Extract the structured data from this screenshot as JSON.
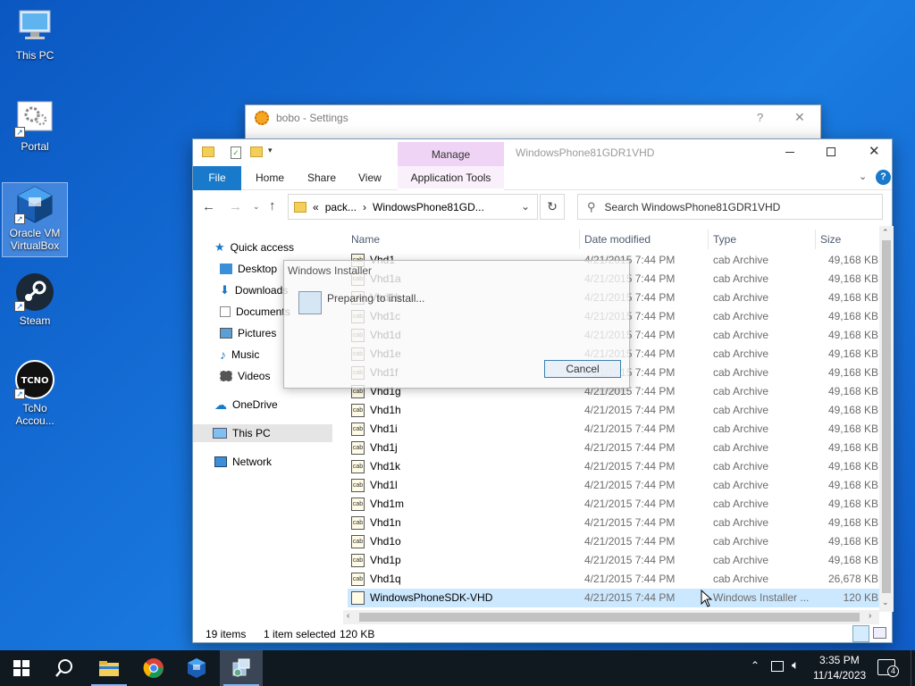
{
  "desktop": {
    "icons": [
      {
        "label": "This PC",
        "icon": "computer-icon"
      },
      {
        "label": "Portal",
        "icon": "gear-icon"
      },
      {
        "label": "Oracle VM VirtualBox",
        "icon": "virtualbox-icon"
      },
      {
        "label": "Steam",
        "icon": "steam-icon"
      },
      {
        "label": "TcNo Accou...",
        "icon": "tcno-icon"
      }
    ]
  },
  "bobo_window": {
    "title": "bobo - Settings",
    "help": "?",
    "close": "✕"
  },
  "explorer": {
    "title": "WindowsPhone81GDR1VHD",
    "manage_tab": "Manage",
    "tabs": {
      "file": "File",
      "home": "Home",
      "share": "Share",
      "view": "View",
      "app_tools": "Application Tools"
    },
    "address": {
      "prefix": "«",
      "part1": "pack...",
      "sep": "›",
      "part2": "WindowsPhone81GD..."
    },
    "search_placeholder": "Search WindowsPhone81GDR1VHD",
    "nav": {
      "quick_access": "Quick access",
      "desktop": "Desktop",
      "downloads": "Downloads",
      "documents": "Documents",
      "pictures": "Pictures",
      "music": "Music",
      "videos": "Videos",
      "onedrive": "OneDrive",
      "this_pc": "This PC",
      "network": "Network"
    },
    "columns": {
      "name": "Name",
      "date": "Date modified",
      "type": "Type",
      "size": "Size"
    },
    "files": [
      {
        "name": "Vhd1",
        "date": "4/21/2015 7:44 PM",
        "type": "cab Archive",
        "size": "49,168 KB"
      },
      {
        "name": "Vhd1a",
        "date": "4/21/2015 7:44 PM",
        "type": "cab Archive",
        "size": "49,168 KB"
      },
      {
        "name": "Vhd1b",
        "date": "4/21/2015 7:44 PM",
        "type": "cab Archive",
        "size": "49,168 KB"
      },
      {
        "name": "Vhd1c",
        "date": "4/21/2015 7:44 PM",
        "type": "cab Archive",
        "size": "49,168 KB"
      },
      {
        "name": "Vhd1d",
        "date": "4/21/2015 7:44 PM",
        "type": "cab Archive",
        "size": "49,168 KB"
      },
      {
        "name": "Vhd1e",
        "date": "4/21/2015 7:44 PM",
        "type": "cab Archive",
        "size": "49,168 KB"
      },
      {
        "name": "Vhd1f",
        "date": "4/21/2015 7:44 PM",
        "type": "cab Archive",
        "size": "49,168 KB"
      },
      {
        "name": "Vhd1g",
        "date": "4/21/2015 7:44 PM",
        "type": "cab Archive",
        "size": "49,168 KB"
      },
      {
        "name": "Vhd1h",
        "date": "4/21/2015 7:44 PM",
        "type": "cab Archive",
        "size": "49,168 KB"
      },
      {
        "name": "Vhd1i",
        "date": "4/21/2015 7:44 PM",
        "type": "cab Archive",
        "size": "49,168 KB"
      },
      {
        "name": "Vhd1j",
        "date": "4/21/2015 7:44 PM",
        "type": "cab Archive",
        "size": "49,168 KB"
      },
      {
        "name": "Vhd1k",
        "date": "4/21/2015 7:44 PM",
        "type": "cab Archive",
        "size": "49,168 KB"
      },
      {
        "name": "Vhd1l",
        "date": "4/21/2015 7:44 PM",
        "type": "cab Archive",
        "size": "49,168 KB"
      },
      {
        "name": "Vhd1m",
        "date": "4/21/2015 7:44 PM",
        "type": "cab Archive",
        "size": "49,168 KB"
      },
      {
        "name": "Vhd1n",
        "date": "4/21/2015 7:44 PM",
        "type": "cab Archive",
        "size": "49,168 KB"
      },
      {
        "name": "Vhd1o",
        "date": "4/21/2015 7:44 PM",
        "type": "cab Archive",
        "size": "49,168 KB"
      },
      {
        "name": "Vhd1p",
        "date": "4/21/2015 7:44 PM",
        "type": "cab Archive",
        "size": "49,168 KB"
      },
      {
        "name": "Vhd1q",
        "date": "4/21/2015 7:44 PM",
        "type": "cab Archive",
        "size": "26,678 KB"
      },
      {
        "name": "WindowsPhoneSDK-VHD",
        "date": "4/21/2015 7:44 PM",
        "type": "Windows Installer ...",
        "size": "120 KB",
        "selected": true
      }
    ],
    "status": {
      "items": "19 items",
      "selected": "1 item selected",
      "size": "120 KB"
    }
  },
  "installer": {
    "title": "Windows Installer",
    "message": "Preparing to install...",
    "cancel": "Cancel"
  },
  "taskbar": {
    "time": "3:35 PM",
    "date": "11/14/2023",
    "notifications": "4"
  },
  "colors": {
    "accent": "#1979ca",
    "manage": "#f0d4f5",
    "selection": "#cce8ff",
    "taskbar": "#101820"
  }
}
